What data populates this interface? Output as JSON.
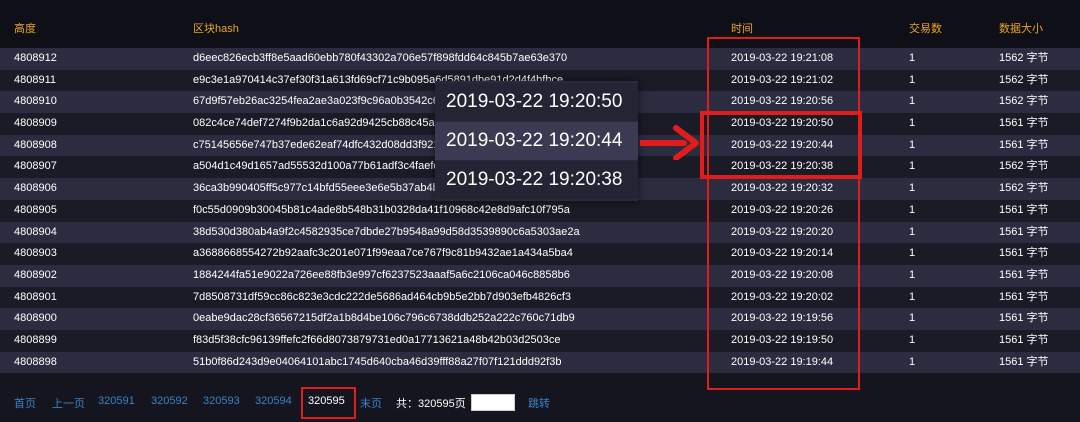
{
  "table": {
    "headers": {
      "height": "高度",
      "hash": "区块hash",
      "time": "时间",
      "tx_count": "交易数",
      "size": "数据大小"
    },
    "rows": [
      {
        "height": "4808912",
        "hash": "d6eec826ecb3ff8e5aad60ebb780f43302a706e57f898fdd64c845b7ae63e370",
        "time": "2019-03-22 19:21:08",
        "tx": "1",
        "size": "1562 字节"
      },
      {
        "height": "4808911",
        "hash": "e9c3e1a970414c37ef30f31a613fd69cf71c9b095a6d5891dbe91d2d4f4bfbce",
        "time": "2019-03-22 19:21:02",
        "tx": "1",
        "size": "1562 字节"
      },
      {
        "height": "4808910",
        "hash": "67d9f57eb26ac3254fea2ae3a023f9c96a0b3542c6",
        "time": "2019-03-22 19:20:56",
        "tx": "1",
        "size": "1562 字节"
      },
      {
        "height": "4808909",
        "hash": "082c4ce74def7274f9b2da1c6a92d9425cb88c45ab",
        "time": "2019-03-22 19:20:50",
        "tx": "1",
        "size": "1561 字节"
      },
      {
        "height": "4808908",
        "hash": "c75145656e747b37ede62eaf74dfc432d08dd3f921",
        "time": "2019-03-22 19:20:44",
        "tx": "1",
        "size": "1561 字节"
      },
      {
        "height": "4808907",
        "hash": "a504d1c49d1657ad55532d100a77b61adf3c4faefc",
        "time": "2019-03-22 19:20:38",
        "tx": "1",
        "size": "1562 字节"
      },
      {
        "height": "4808906",
        "hash": "36ca3b990405ff5c977c14bfd55eee3e6e5b37ab4b",
        "time": "2019-03-22 19:20:32",
        "tx": "1",
        "size": "1562 字节"
      },
      {
        "height": "4808905",
        "hash": "f0c55d0909b30045b81c4ade8b548b31b0328da41f10968c42e8d9afc10f795a",
        "time": "2019-03-22 19:20:26",
        "tx": "1",
        "size": "1561 字节"
      },
      {
        "height": "4808904",
        "hash": "38d530d380ab4a9f2c4582935ce7dbde27b9548a99d58d3539890c6a5303ae2a",
        "time": "2019-03-22 19:20:20",
        "tx": "1",
        "size": "1561 字节"
      },
      {
        "height": "4808903",
        "hash": "a3688668554272b92aafc3c201e071f99eaa7ce767f9c81b9432ae1a434a5ba4",
        "time": "2019-03-22 19:20:14",
        "tx": "1",
        "size": "1561 字节"
      },
      {
        "height": "4808902",
        "hash": "1884244fa51e9022a726ee88fb3e997cf6237523aaaf5a6c2106ca046c8858b6",
        "time": "2019-03-22 19:20:08",
        "tx": "1",
        "size": "1561 字节"
      },
      {
        "height": "4808901",
        "hash": "7d8508731df59cc86c823e3cdc222de5686ad464cb9b5e2bb7d903efb4826cf3",
        "time": "2019-03-22 19:20:02",
        "tx": "1",
        "size": "1561 字节"
      },
      {
        "height": "4808900",
        "hash": "0eabe9dac28cf36567215df2a1b8d4be106c796c6738ddb252a222c760c71db9",
        "time": "2019-03-22 19:19:56",
        "tx": "1",
        "size": "1561 字节"
      },
      {
        "height": "4808899",
        "hash": "f83d5f38cfc96139ffefc2f66d8073879731ed0a17713621a48b42b03d2503ce",
        "time": "2019-03-22 19:19:50",
        "tx": "1",
        "size": "1561 字节"
      },
      {
        "height": "4808898",
        "hash": "51b0f86d243d9e04064101abc1745d640cba46d39fff88a27f07f121ddd92f3b",
        "time": "2019-03-22 19:19:44",
        "tx": "1",
        "size": "1561 字节"
      }
    ]
  },
  "pager": {
    "first": "首页",
    "prev": "上一页",
    "pages": [
      "320591",
      "320592",
      "320593",
      "320594"
    ],
    "current": "320595",
    "last": "末页",
    "total": "共：320595页",
    "jump": "跳转"
  },
  "zoom": {
    "lines": [
      "2019-03-22 19:20:50",
      "2019-03-22 19:20:44",
      "2019-03-22 19:20:38"
    ]
  },
  "colors": {
    "header_text": "#e8a528",
    "link": "#3b82c4",
    "highlight_box": "#e11c1c",
    "row_odd": "#2c2c40",
    "row_even": "#1b1b27"
  }
}
